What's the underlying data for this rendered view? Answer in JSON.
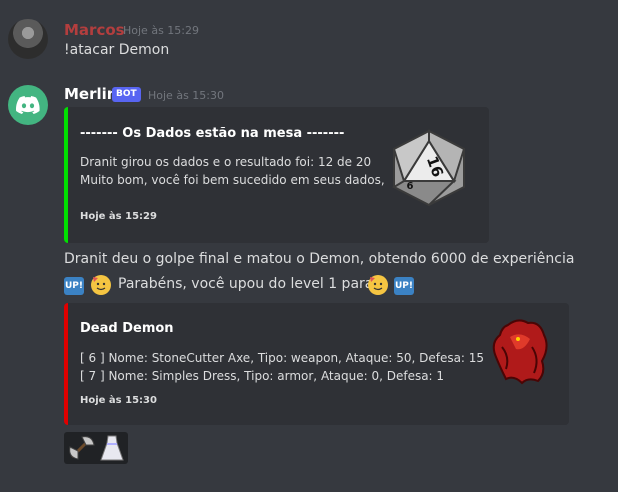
{
  "msg1": {
    "author": "Marcos",
    "timestamp": "Hoje às 15:29",
    "text": "!atacar Demon"
  },
  "msg2": {
    "author": "Merlin",
    "bot_tag": "BOT",
    "timestamp": "Hoje às 15:30",
    "embed1": {
      "title": "-------  Os Dados estão na mesa  -------",
      "line1": "Dranit girou os dados e o resultado foi: 12 de 20",
      "line2": "Muito bom, você foi bem sucedido em seus dados,",
      "footer": "Hoje às 15:29",
      "die_face": "16",
      "die_face_small": "6"
    },
    "line1": "Dranit deu o golpe final e matou o Demon, obtendo 6000 de experiência",
    "up_label": "UP!",
    "line2": "Parabéns, você upou do level 1 para 2",
    "embed2": {
      "title": "Dead Demon",
      "line1": "[ 6 ] Nome: StoneCutter Axe, Tipo: weapon, Ataque: 50, Defesa: 15",
      "line2": "[ 7 ] Nome: Simples Dress, Tipo: armor, Ataque: 0, Defesa: 1",
      "footer": "Hoje às 15:30"
    }
  },
  "colors": {
    "embed1_accent": "#00e000",
    "embed2_accent": "#e00000",
    "marcos_name": "#b33e3e",
    "bot_tag": "#5865f2",
    "discord_green": "#43b581"
  },
  "icons": [
    "discord-logo-icon",
    "d20-die-icon",
    "party-face-icon",
    "demon-icon",
    "axe-icon",
    "dress-icon"
  ]
}
